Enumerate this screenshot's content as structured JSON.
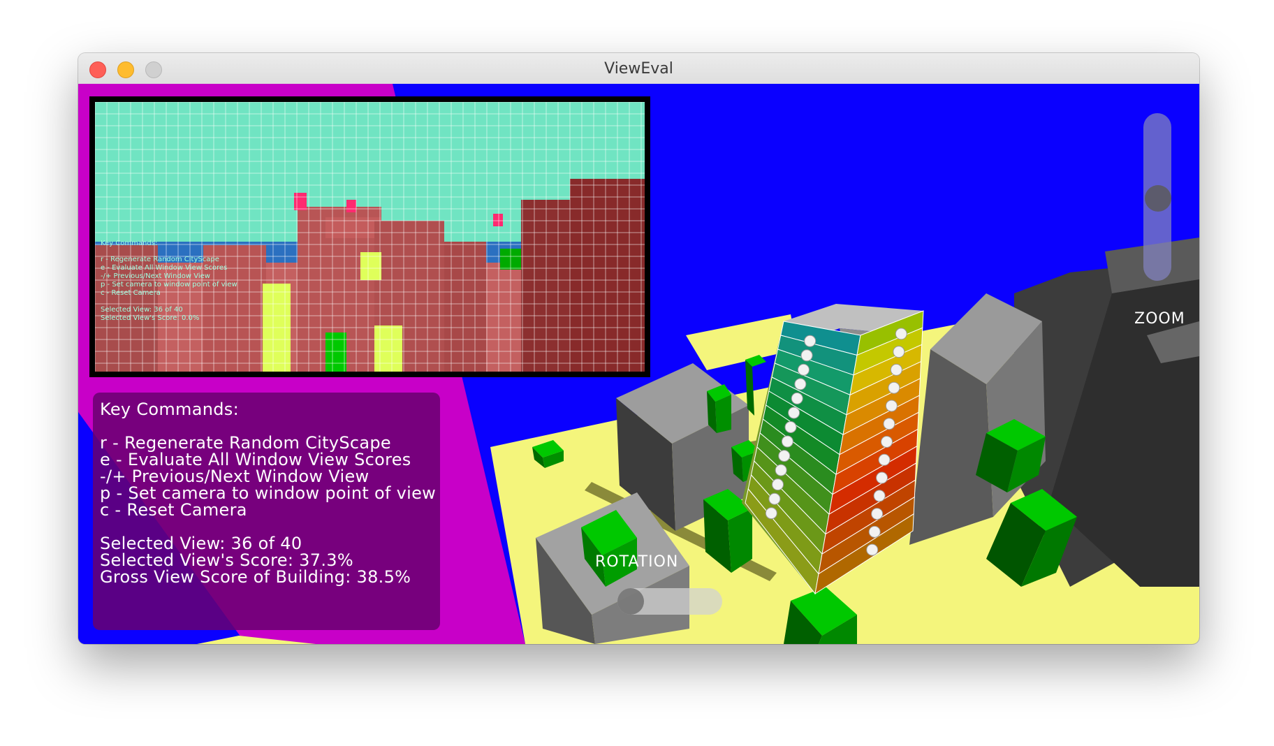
{
  "window": {
    "title": "ViewEval"
  },
  "key_panel": {
    "heading": "Key Commands:",
    "commands": [
      "r - Regenerate Random CityScape",
      "e - Evaluate All Window View Scores",
      "-/+ Previous/Next Window View",
      "p - Set camera to window point of view",
      "c - Reset Camera"
    ],
    "selected_view": "Selected View: 36 of 40",
    "selected_score": "Selected View's Score: 37.3%",
    "gross_score": "Gross View Score of Building: 38.5%"
  },
  "inset_overlay": {
    "heading": "Key Commands:",
    "commands": [
      "r - Regenerate Random CityScape",
      "e - Evaluate All Window View Scores",
      "-/+ Previous/Next Window View",
      "p - Set camera to window point of view",
      "c - Reset Camera"
    ],
    "selected_view": "Selected View: 36 of 40",
    "selected_score": "Selected View's Score: 0.0%"
  },
  "controls": {
    "zoom_label": "ZOOM",
    "rotation_label": "ROTATION",
    "zoom_level": 0.5,
    "rotation_level": 0.0
  },
  "colors": {
    "sky": "#0a00ff",
    "ground": "#f4f57c",
    "magenta_plane": "#c800c8",
    "green_block": "#00aa00",
    "gray_block": "#7a7a7a",
    "inset_sky": "#70e4c2",
    "inset_building": "#b85555"
  }
}
